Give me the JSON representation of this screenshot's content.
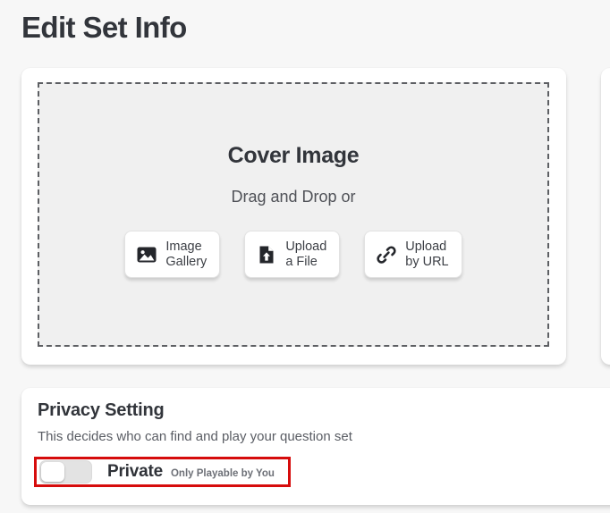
{
  "page": {
    "title": "Edit Set Info",
    "background_color": "#f7f7f7"
  },
  "cover_section": {
    "heading": "Cover Image",
    "subheading": "Drag and Drop or",
    "buttons": [
      {
        "icon": "image-gallery-icon",
        "label": "Image\nGallery"
      },
      {
        "icon": "file-upload-icon",
        "label": "Upload\na File"
      },
      {
        "icon": "link-chain-icon",
        "label": "Upload\nby URL"
      }
    ]
  },
  "privacy_section": {
    "title": "Privacy Setting",
    "description": "This decides who can find and play your question set",
    "toggle": {
      "state": "off",
      "label": "Private",
      "hint": "Only Playable by You",
      "highlight_color": "#d60c0c",
      "track_color": "#e3e3e3",
      "knob_color": "#ffffff"
    }
  }
}
